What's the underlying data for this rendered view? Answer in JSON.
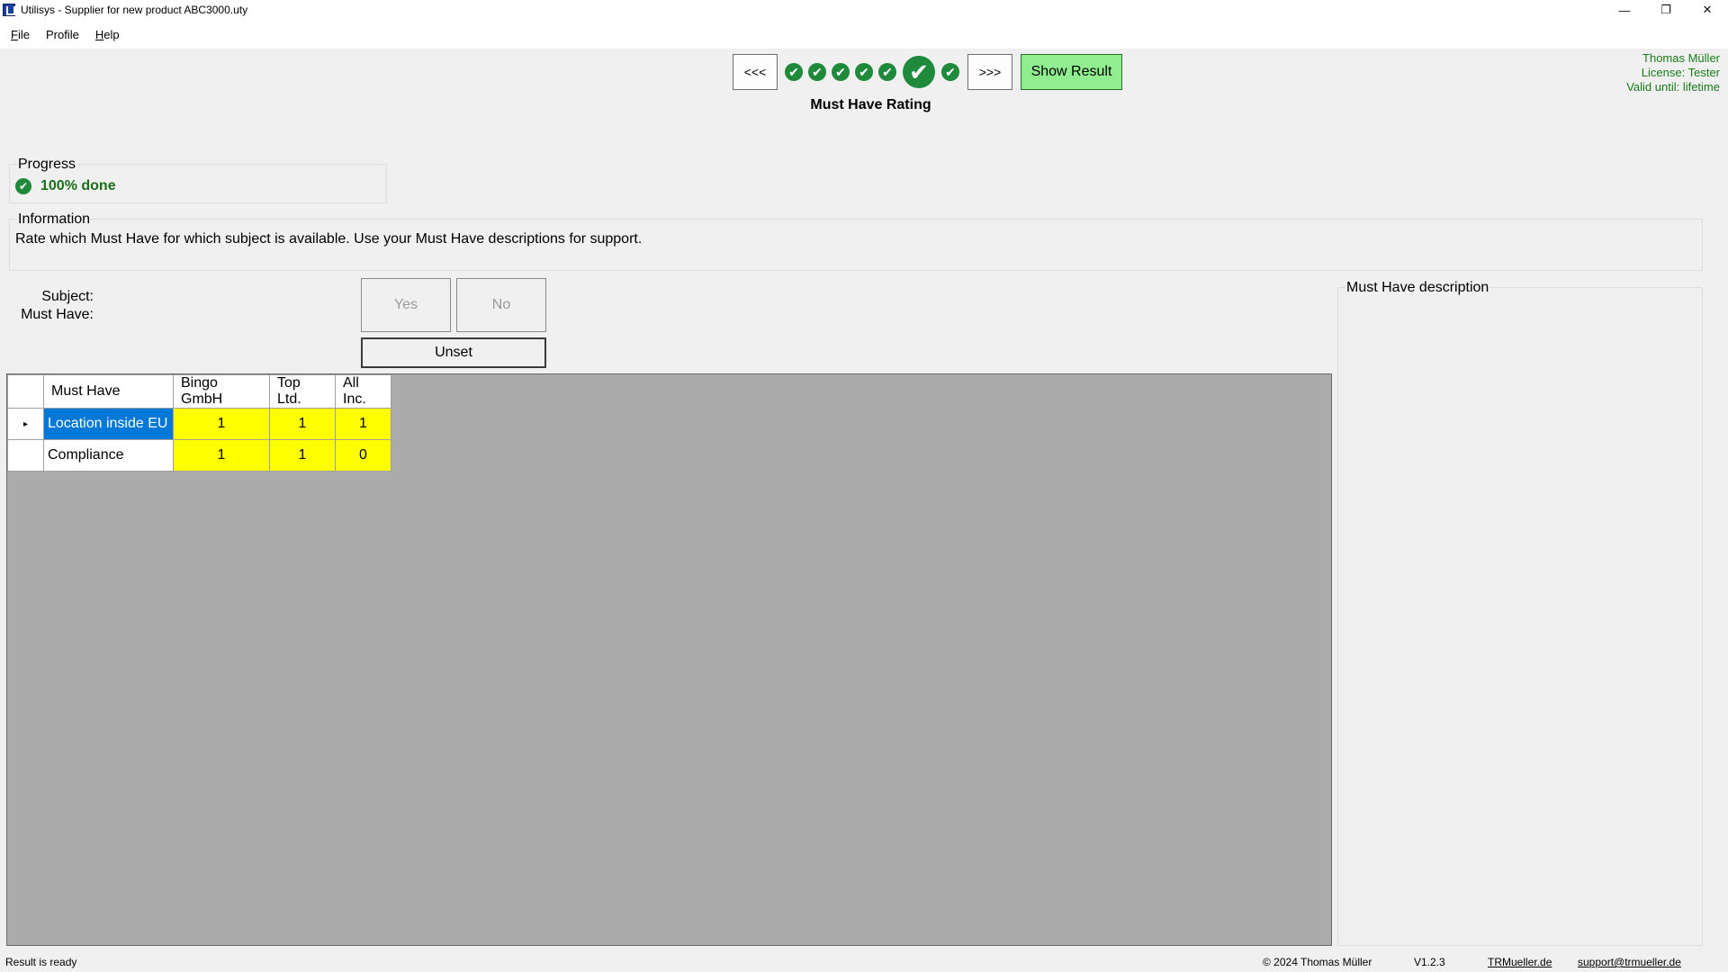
{
  "window": {
    "title": "Utilisys - Supplier for new product ABC3000.uty",
    "minimize_glyph": "—",
    "restore_glyph": "❐",
    "close_glyph": "✕"
  },
  "menu": {
    "file": {
      "u": "F",
      "rest": "ile"
    },
    "profile": {
      "pre": "Profile"
    },
    "help": {
      "u": "H",
      "rest": "elp"
    }
  },
  "nav": {
    "prev_label": "<<<",
    "next_label": ">>>",
    "show_result_label": "Show Result",
    "step_title": "Must Have Rating",
    "check_glyph": "✔",
    "current_step_index": 6,
    "total_steps": 7
  },
  "user": {
    "name": "Thomas Müller",
    "license": "License: Tester",
    "valid": "Valid until: lifetime"
  },
  "progress": {
    "label": "Progress",
    "status": "100% done",
    "percent": 100
  },
  "information": {
    "label": "Information",
    "text": "Rate which Must Have for which subject is available. Use your Must Have descriptions for support."
  },
  "rating": {
    "subject_label": "Subject:",
    "must_have_label": "Must Have:",
    "yes_label": "Yes",
    "no_label": "No",
    "unset_label": "Unset"
  },
  "grid": {
    "headers": [
      "Must Have",
      "Bingo GmbH",
      "Top Ltd.",
      "All Inc."
    ],
    "rows": [
      {
        "name": "Location inside EU",
        "values": [
          "1",
          "1",
          "1"
        ],
        "selected": true
      },
      {
        "name": "Compliance",
        "values": [
          "1",
          "1",
          "0"
        ],
        "selected": false
      }
    ],
    "row_indicator": "▸"
  },
  "description": {
    "label": "Must Have description"
  },
  "status": {
    "left": "Result is ready",
    "copyright": "© 2024 Thomas Müller",
    "version": "V1.2.3",
    "website": "TRMueller.de",
    "email": "support@trmueller.de"
  },
  "colors": {
    "accent_green": "#1f8a3c",
    "show_result_bg": "#90ee90",
    "selection_blue": "#0078d7",
    "cell_yellow": "#ffff00",
    "user_text_green": "#1a7a1a"
  }
}
